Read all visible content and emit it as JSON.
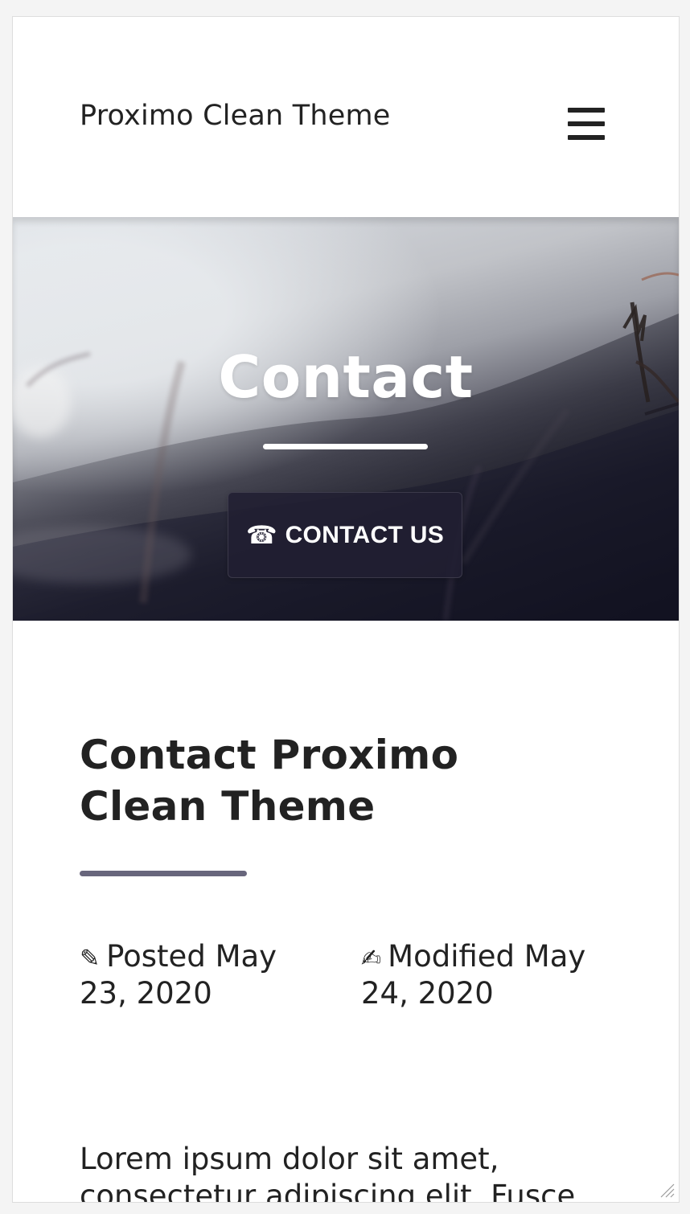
{
  "header": {
    "site_title": "Proximo Clean Theme",
    "menu_icon": "hamburger-menu-icon"
  },
  "hero": {
    "title": "Contact",
    "button_icon": "☎",
    "button_label": "CONTACT US"
  },
  "page": {
    "title": "Contact Proximo Clean Theme",
    "posted_icon": "✎",
    "posted_text": "Posted May 23, 2020",
    "modified_icon": "✍",
    "modified_text": "Modified May 24, 2020",
    "body_text": "Lorem ipsum dolor sit amet, consectetur adipiscing elit. Fusce"
  },
  "colors": {
    "page_background": "#f4f4f4",
    "text": "#222222",
    "divider": "#68667c",
    "button": "#211f32"
  }
}
